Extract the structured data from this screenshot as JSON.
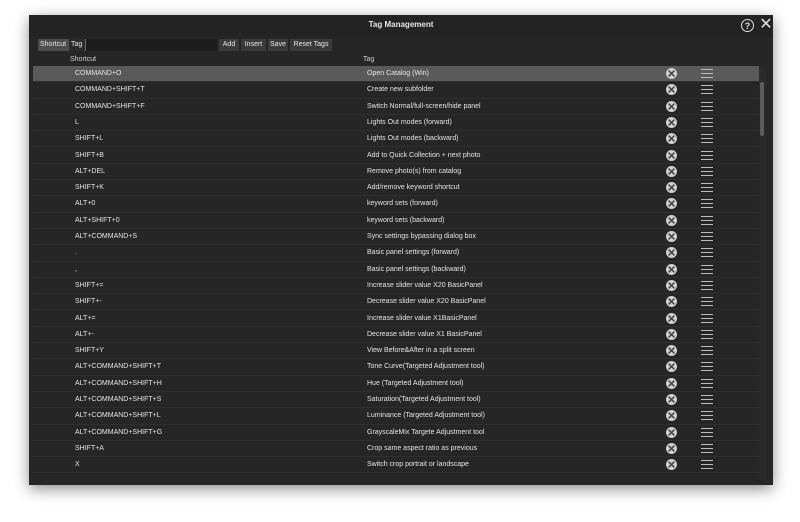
{
  "window": {
    "title": "Tag Management"
  },
  "titlebar": {
    "help_glyph": "?",
    "close_glyph": "✕"
  },
  "toolbar": {
    "tabs": [
      "Shortcut",
      "Tag"
    ],
    "filter_value": "",
    "buttons": [
      "Add",
      "Insert",
      "Save",
      "Reset Tags"
    ]
  },
  "columns": {
    "shortcut": "Shortcut",
    "tag": "Tag"
  },
  "rows": [
    {
      "shortcut": "COMMAND+O",
      "tag": "Open Catalog (Win)"
    },
    {
      "shortcut": "COMMAND+SHIFT+T",
      "tag": "Create new subfolder"
    },
    {
      "shortcut": "COMMAND+SHIFT+F",
      "tag": "Switch Normal/full-screen/hide panel"
    },
    {
      "shortcut": "L",
      "tag": "Lights Out modes (forward)"
    },
    {
      "shortcut": "SHIFT+L",
      "tag": "Lights Out modes (backward)"
    },
    {
      "shortcut": "SHIFT+B",
      "tag": "Add to Quick Collection + next photo"
    },
    {
      "shortcut": "ALT+DEL",
      "tag": "Remove photo(s) from catalog"
    },
    {
      "shortcut": "SHIFT+K",
      "tag": "Add/remove keyword shortcut"
    },
    {
      "shortcut": "ALT+0",
      "tag": "keyword sets (forward)"
    },
    {
      "shortcut": "ALT+SHIFT+0",
      "tag": "keyword sets (backward)"
    },
    {
      "shortcut": "ALT+COMMAND+S",
      "tag": "Sync settings bypassing dialog box"
    },
    {
      "shortcut": ".",
      "tag": "Basic panel settings (forward)"
    },
    {
      "shortcut": ",",
      "tag": "Basic panel settings (backward)"
    },
    {
      "shortcut": "SHIFT+=",
      "tag": "Increase slider value X20 BasicPanel"
    },
    {
      "shortcut": "SHIFT+-",
      "tag": "Decrease slider value X20 BasicPanel"
    },
    {
      "shortcut": "ALT+=",
      "tag": "Increase slider value X1BasicPanel"
    },
    {
      "shortcut": "ALT+-",
      "tag": "Decrease slider value X1 BasicPanel"
    },
    {
      "shortcut": "SHIFT+Y",
      "tag": "View Before&After in a split screen"
    },
    {
      "shortcut": "ALT+COMMAND+SHIFT+T",
      "tag": "Tone Curve(Targeted Adjustment tool)"
    },
    {
      "shortcut": "ALT+COMMAND+SHIFT+H",
      "tag": "Hue (Targeted Adjustment tool)"
    },
    {
      "shortcut": "ALT+COMMAND+SHIFT+S",
      "tag": "Saturation(Targeted Adjustment tool)"
    },
    {
      "shortcut": "ALT+COMMAND+SHIFT+L",
      "tag": "Luminance (Targeted Adjustment tool)"
    },
    {
      "shortcut": "ALT+COMMAND+SHIFT+G",
      "tag": "GrayscaleMix Targete Adjustment tool"
    },
    {
      "shortcut": "SHIFT+A",
      "tag": "Crop same aspect ratio as previous"
    },
    {
      "shortcut": "X",
      "tag": "Switch crop portrait or landscape"
    }
  ],
  "selected_row": 0,
  "icons": {
    "delete": "delete-circle-x-icon",
    "drag": "drag-handle-icon",
    "help": "help-icon",
    "close": "close-icon"
  },
  "colors": {
    "window_bg": "#262626",
    "selected_row": "#5a5a5a",
    "text": "#e4e4e4"
  }
}
